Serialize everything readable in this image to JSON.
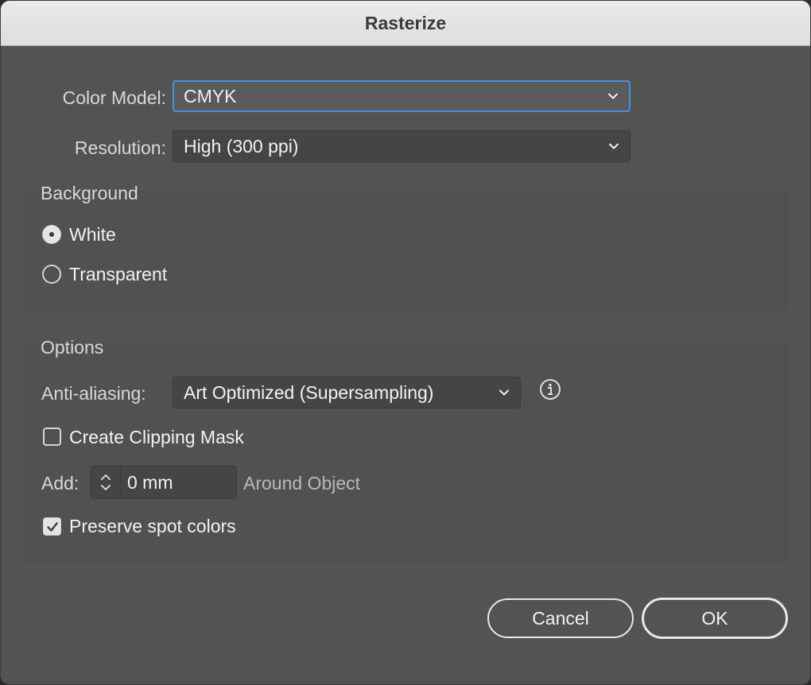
{
  "window": {
    "title": "Rasterize"
  },
  "color_model": {
    "label": "Color Model:",
    "value": "CMYK"
  },
  "resolution": {
    "label": "Resolution:",
    "value": "High (300 ppi)"
  },
  "background": {
    "title": "Background",
    "options": [
      {
        "label": "White",
        "selected": true
      },
      {
        "label": "Transparent",
        "selected": false
      }
    ]
  },
  "options": {
    "title": "Options",
    "anti_aliasing": {
      "label": "Anti-aliasing:",
      "value": "Art Optimized (Supersampling)"
    },
    "clipping_mask": {
      "label": "Create Clipping Mask",
      "checked": false
    },
    "add": {
      "label": "Add:",
      "value": "0 mm",
      "suffix": "Around Object"
    },
    "preserve_spot": {
      "label": "Preserve spot colors",
      "checked": true
    }
  },
  "buttons": {
    "cancel": "Cancel",
    "ok": "OK"
  },
  "icons": {
    "dropdown": "chevron-down-icon",
    "info": "info-icon",
    "stepper": "stepper-arrows-icon",
    "checkmark": "checkmark-icon"
  },
  "colors": {
    "focus": "#4a90d9",
    "dialog_bg": "#535353"
  }
}
